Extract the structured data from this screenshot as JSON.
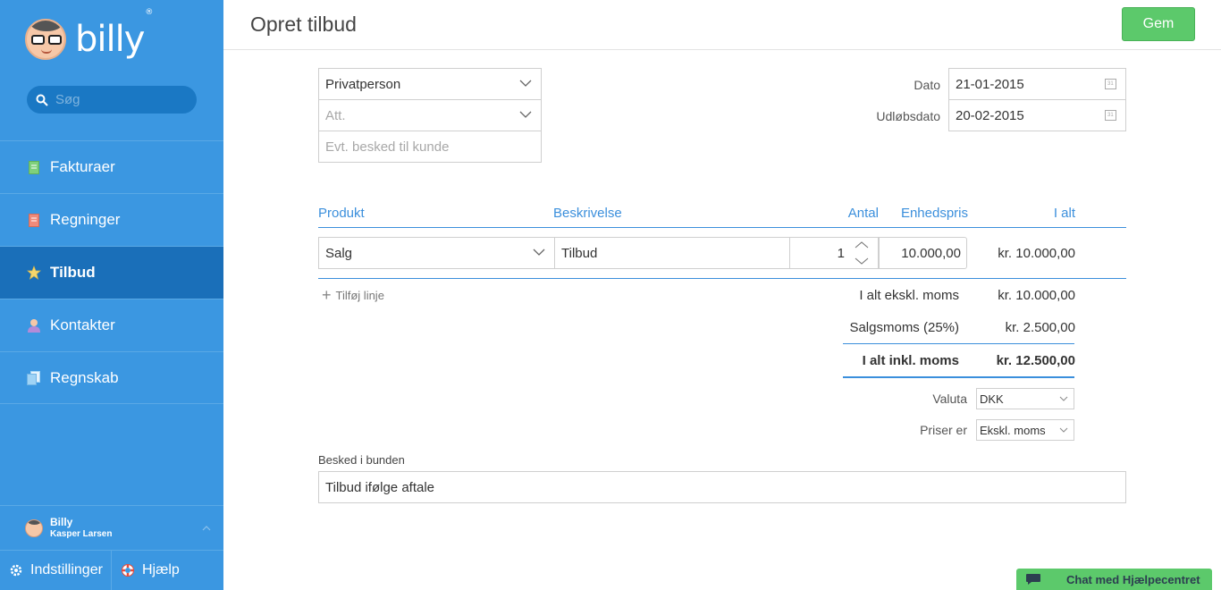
{
  "app": {
    "name": "billy",
    "reg": "®"
  },
  "search": {
    "placeholder": "Søg"
  },
  "sidebar": {
    "items": [
      {
        "label": "Fakturaer",
        "icon": "invoice-icon",
        "color": "#7fd07c"
      },
      {
        "label": "Regninger",
        "icon": "bill-icon",
        "color": "#f08a7a"
      },
      {
        "label": "Tilbud",
        "icon": "star-icon",
        "color": "#f5d76e",
        "active": true
      },
      {
        "label": "Kontakter",
        "icon": "person-icon",
        "color": "#b38bd8"
      },
      {
        "label": "Regnskab",
        "icon": "ledger-icon",
        "color": "#9fd3f5"
      }
    ],
    "user": {
      "name": "Billy",
      "sub": "Kasper Larsen"
    },
    "settings": "Indstillinger",
    "help": "Hjælp"
  },
  "header": {
    "title": "Opret tilbud",
    "save": "Gem"
  },
  "form": {
    "customer": "Privatperson",
    "att_placeholder": "Att.",
    "message_placeholder": "Evt. besked til kunde",
    "date_label": "Dato",
    "date_value": "21-01-2015",
    "expiry_label": "Udløbsdato",
    "expiry_value": "20-02-2015"
  },
  "table": {
    "headers": {
      "product": "Produkt",
      "description": "Beskrivelse",
      "qty": "Antal",
      "unit_price": "Enhedspris",
      "total": "I alt"
    },
    "rows": [
      {
        "product": "Salg",
        "description": "Tilbud",
        "qty": "1",
        "unit_price": "10.000,00",
        "total": "kr. 10.000,00"
      }
    ],
    "add_line": "Tilføj linje"
  },
  "summary": {
    "subtotal_label": "I alt ekskl. moms",
    "subtotal_value": "kr. 10.000,00",
    "vat_label": "Salgsmoms (25%)",
    "vat_value": "kr. 2.500,00",
    "total_label": "I alt inkl. moms",
    "total_value": "kr. 12.500,00",
    "currency_label": "Valuta",
    "currency_value": "DKK",
    "prices_label": "Priser er",
    "prices_value": "Ekskl. moms"
  },
  "footer_message": {
    "label": "Besked i bunden",
    "value": "Tilbud ifølge aftale"
  },
  "chat": {
    "label": "Chat med Hjælpecentret"
  }
}
